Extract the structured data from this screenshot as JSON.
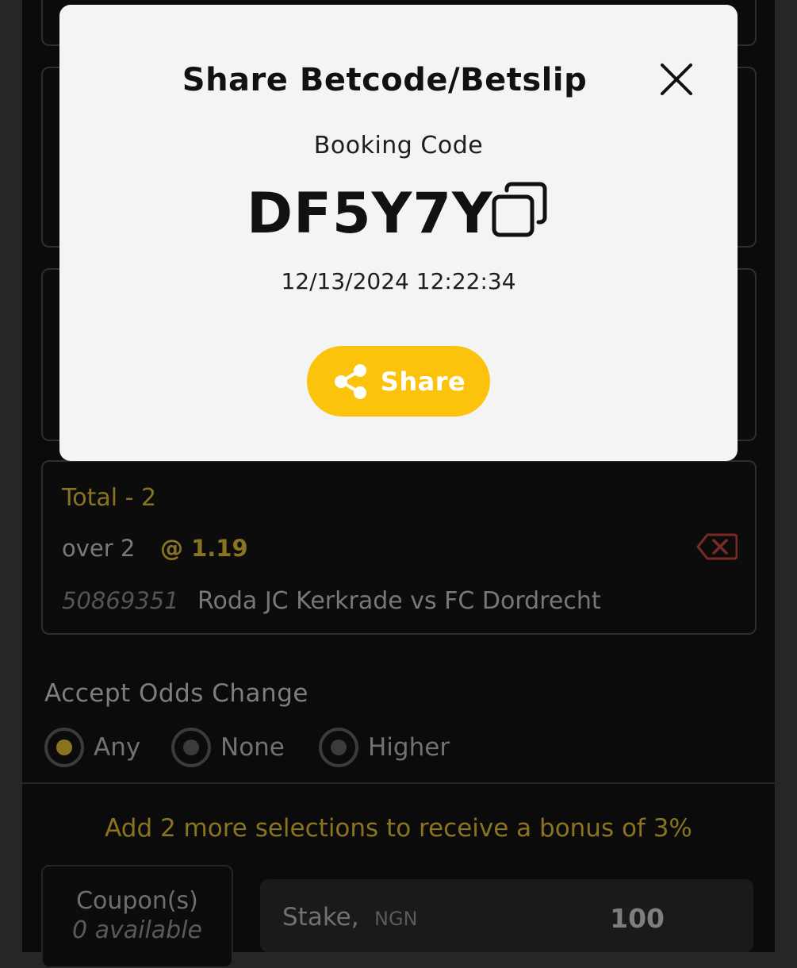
{
  "bet": {
    "market": "Total - 2",
    "pick": "over 2",
    "odds": "@ 1.19",
    "event_id": "50869351",
    "match": "Roda JC Kerkrade vs FC Dordrecht"
  },
  "odds_change": {
    "title": "Accept Odds Change",
    "options": [
      {
        "label": "Any",
        "selected": true
      },
      {
        "label": "None",
        "selected": false
      },
      {
        "label": "Higher",
        "selected": false
      }
    ]
  },
  "bonus_message": "Add 2 more selections to receive a bonus of 3%",
  "coupon": {
    "label": "Coupon(s)",
    "available": "0 available"
  },
  "stake": {
    "label": "Stake,",
    "currency": "NGN",
    "value": "100"
  },
  "modal": {
    "title": "Share Betcode/Betslip",
    "subtitle": "Booking Code",
    "code": "DF5Y7Y",
    "timestamp": "12/13/2024 12:22:34",
    "share_label": "Share",
    "close_icon": "close-icon",
    "copy_icon": "copy-icon",
    "share_icon": "share-icon"
  },
  "colors": {
    "accent": "#fbc30c",
    "muted_gold": "#8a7420",
    "delete": "#7a2a26",
    "background": "#0b0b0b",
    "modal": "#f4f4f4"
  }
}
